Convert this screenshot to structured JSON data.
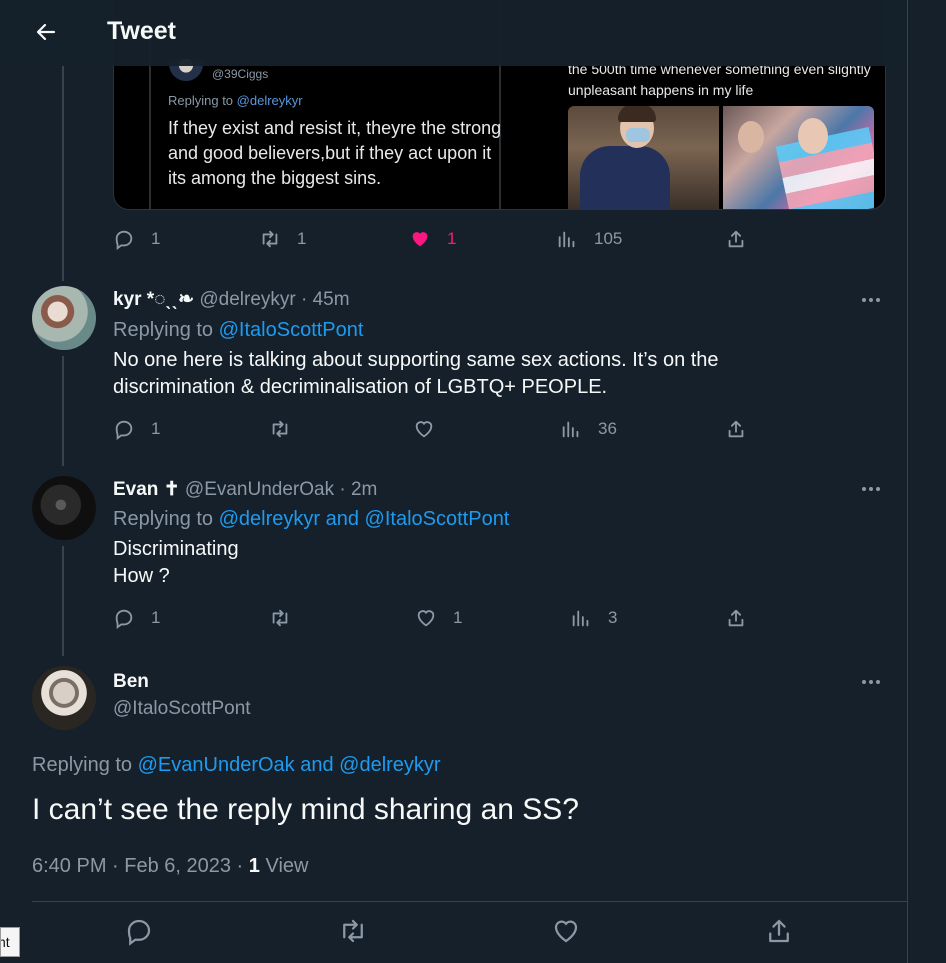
{
  "header": {
    "title": "Tweet"
  },
  "quoted": {
    "handle": "@39Ciggs",
    "replying_prefix": "Replying to ",
    "replying_to": "@delreykyr",
    "text": "If they exist and resist it, theyre the strong and good believers,but if they act upon it its among the biggest sins.",
    "right_text": "the 500th time whenever something even slightly unpleasant happens in my life"
  },
  "top_actions": {
    "reply_count": "1",
    "retweet_count": "1",
    "like_count": "1",
    "views_count": "105"
  },
  "tweets": [
    {
      "name": "kyr *◌ˎˎ❧",
      "handle": "@delreykyr · 45m",
      "replying_prefix": "Replying to ",
      "replying_to": "@ItaloScottPont",
      "body": "No one here is talking about supporting same sex actions. It’s on the discrimination & decriminalisation of LGBTQ+ PEOPLE.",
      "reply_count": "1",
      "retweet_count": "",
      "like_count": "",
      "views_count": "36"
    },
    {
      "name": "Evan ✝",
      "handle": "@EvanUnderOak · 2m",
      "replying_prefix": "Replying to ",
      "replying_to": "@delreykyr and @ItaloScottPont",
      "body_line1": "Discriminating",
      "body_line2": "How ?",
      "reply_count": "1",
      "retweet_count": "",
      "like_count": "1",
      "views_count": "3"
    }
  ],
  "main": {
    "name": "Ben",
    "handle": "@ItaloScottPont",
    "replying_prefix": "Replying to ",
    "replying_to": "@EvanUnderOak and @delreykyr",
    "text": "I can’t see the reply mind sharing an SS?",
    "time": "6:40 PM · Feb 6, 2023 · ",
    "views_count": "1",
    "views_label": " View"
  },
  "tooltip": {
    "text": "nt"
  },
  "colors": {
    "background": "#15202b",
    "accent": "#1d9bf0",
    "like": "#f91880",
    "muted": "#8b98a5"
  }
}
